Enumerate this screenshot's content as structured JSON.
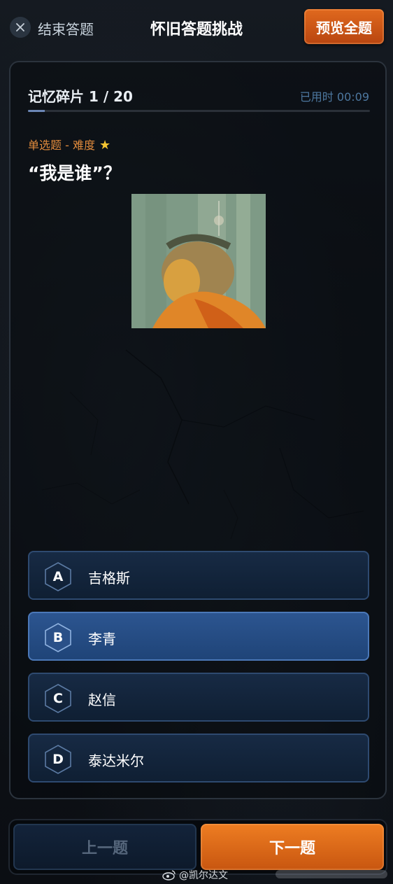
{
  "header": {
    "end_label": "结束答题",
    "title": "怀旧答题挑战",
    "preview_label": "预览全题"
  },
  "status": {
    "fragment": "记忆碎片 1 / 20",
    "timer": "已用时 00:09",
    "progress": 0.05
  },
  "question": {
    "type": "单选题 - 难度",
    "difficulty_stars": 1,
    "text": "“我是谁”？"
  },
  "options": [
    {
      "letter": "A",
      "text": "吉格斯",
      "selected": false
    },
    {
      "letter": "B",
      "text": "李青",
      "selected": true
    },
    {
      "letter": "C",
      "text": "赵信",
      "selected": false
    },
    {
      "letter": "D",
      "text": "泰达米尔",
      "selected": false
    }
  ],
  "footer": {
    "prev_label": "上一题",
    "next_label": "下一题"
  },
  "watermark": {
    "text": "@凯尔达文"
  },
  "colors": {
    "accent_orange": "#e0691e",
    "selected_blue": "#2c5590",
    "option_border": "#2e4a70"
  }
}
